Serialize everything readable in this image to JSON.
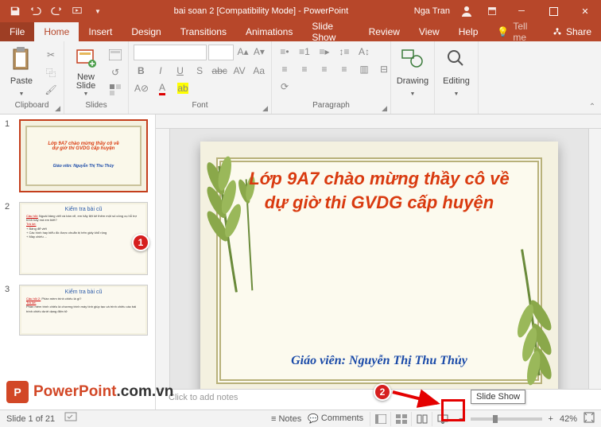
{
  "titlebar": {
    "title": "bai soan 2 [Compatibility Mode] - PowerPoint",
    "user": "Nga Tran"
  },
  "tabs": {
    "file": "File",
    "home": "Home",
    "insert": "Insert",
    "design": "Design",
    "transitions": "Transitions",
    "animations": "Animations",
    "slideshow": "Slide Show",
    "review": "Review",
    "view": "View",
    "help": "Help",
    "tellme": "Tell me",
    "share": "Share"
  },
  "ribbon": {
    "clipboard": {
      "label": "Clipboard",
      "paste": "Paste"
    },
    "slides": {
      "label": "Slides",
      "newslide": "New\nSlide"
    },
    "font": {
      "label": "Font"
    },
    "paragraph": {
      "label": "Paragraph"
    },
    "drawing": {
      "label": "Drawing"
    },
    "editing": {
      "label": "Editing"
    }
  },
  "thumbs": {
    "s1": {
      "num": "1",
      "title": "Lớp 9A7 chào mừng thầy cô về",
      "title2": "dự giờ thi GVDG cấp huyện",
      "sub": "Giáo viên: Nguyễn Thị Thu Thủy"
    },
    "s2": {
      "num": "2",
      "title": "Kiểm tra bài cũ"
    },
    "s3": {
      "num": "3",
      "title": "Kiểm tra bài cũ"
    }
  },
  "slide": {
    "title_l1": "Lớp 9A7 chào mừng thầy cô về",
    "title_l2": "dự giờ thi GVDG cấp huyện",
    "teacher": "Giáo viên: Nguyễn Thị Thu Thủy"
  },
  "notes": {
    "placeholder": "Click to add notes"
  },
  "status": {
    "slidecount": "Slide 1 of 21",
    "lang": "",
    "notes": "Notes",
    "comments": "Comments",
    "zoom": "42%"
  },
  "tooltip": {
    "slideshow": "Slide Show"
  },
  "callouts": {
    "c1": "1",
    "c2": "2"
  },
  "watermark": {
    "p1": "PowerPoint",
    "p2": ".com.vn"
  }
}
